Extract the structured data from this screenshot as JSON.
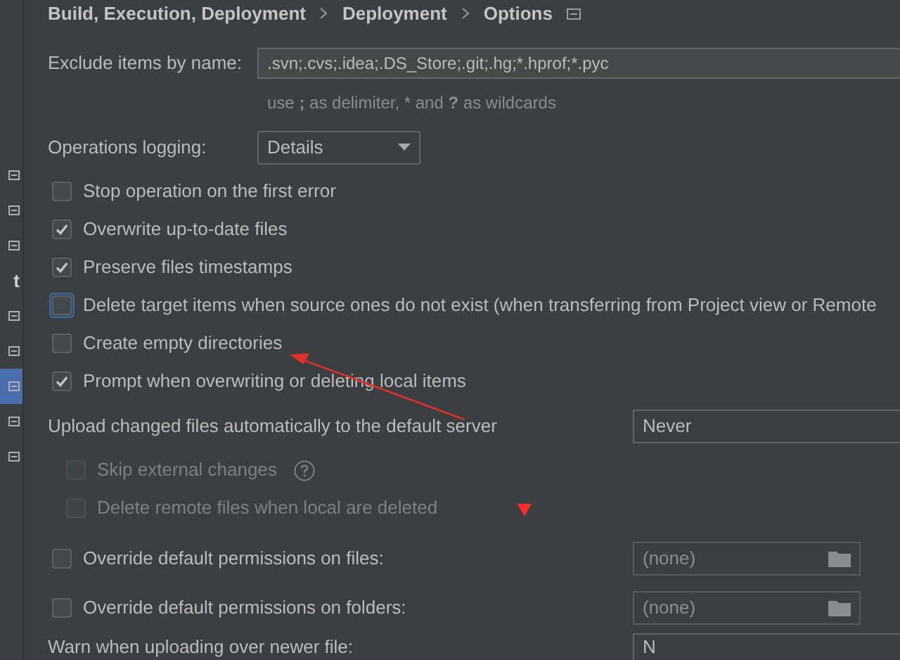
{
  "sidebar": {
    "items": [
      {
        "kind": "icon",
        "selected": false
      },
      {
        "kind": "icon",
        "selected": false
      },
      {
        "kind": "icon",
        "selected": false
      },
      {
        "kind": "text",
        "text": "t",
        "selected": false
      },
      {
        "kind": "icon",
        "selected": false
      },
      {
        "kind": "icon",
        "selected": false
      },
      {
        "kind": "icon",
        "selected": true
      },
      {
        "kind": "icon",
        "selected": false
      },
      {
        "kind": "icon",
        "selected": false
      }
    ]
  },
  "breadcrumb": [
    "Build, Execution, Deployment",
    "Deployment",
    "Options"
  ],
  "exclude": {
    "label": "Exclude items by name:",
    "value": ".svn;.cvs;.idea;.DS_Store;.git;.hg;*.hprof;*.pyc",
    "hint": "use **;** as delimiter, * and **?** as wildcards"
  },
  "logging": {
    "label": "Operations logging:",
    "value": "Details"
  },
  "options": [
    {
      "label": "Stop operation on the first error",
      "checked": false,
      "focused": false
    },
    {
      "label": "Overwrite up-to-date files",
      "checked": true,
      "focused": false
    },
    {
      "label": "Preserve files timestamps",
      "checked": true,
      "focused": false
    },
    {
      "label": "Delete target items when source ones do not exist (when transferring from Project view or Remote",
      "checked": false,
      "focused": true
    },
    {
      "label": "Create empty directories",
      "checked": false,
      "focused": false
    },
    {
      "label": "Prompt when overwriting or deleting local items",
      "checked": true,
      "focused": false
    }
  ],
  "upload": {
    "label": "Upload changed files automatically to the default server",
    "value": "Never",
    "sub_options": [
      {
        "label": "Skip external changes",
        "checked": false,
        "disabled": true,
        "help": true
      },
      {
        "label": "Delete remote files when local are deleted",
        "checked": false,
        "disabled": true,
        "help": false
      }
    ]
  },
  "permissions": [
    {
      "label": "Override default permissions on files:",
      "checked": false,
      "value": "(none)"
    },
    {
      "label": "Override default permissions on folders:",
      "checked": false,
      "value": "(none)"
    }
  ],
  "warn": {
    "label": "Warn when uploading over newer file:",
    "value": "N"
  }
}
